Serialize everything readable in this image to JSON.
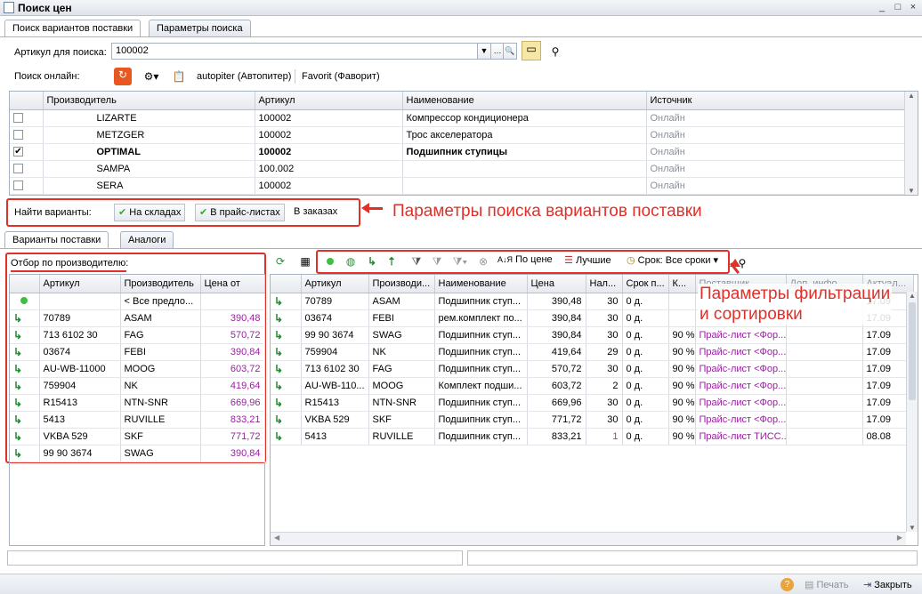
{
  "window": {
    "title": "Поиск цен",
    "buttons": [
      "_",
      "□",
      "×"
    ]
  },
  "top_tabs": [
    "Поиск вариантов поставки",
    "Параметры поиска"
  ],
  "search": {
    "label": "Артикул для поиска:",
    "value": "100002"
  },
  "online": {
    "label": "Поиск онлайн:",
    "sources": [
      "autopiter (Автопитер)",
      "Favorit (Фаворит)"
    ]
  },
  "variants_grid": {
    "columns": [
      "Производитель",
      "Артикул",
      "Наименование",
      "Источник"
    ],
    "rows": [
      {
        "checked": false,
        "maker": "LIZARTE",
        "article": "100002",
        "name": "Компрессор кондиционера",
        "source": "Онлайн",
        "bold": false
      },
      {
        "checked": false,
        "maker": "METZGER",
        "article": "100002",
        "name": "Трос акселератора",
        "source": "Онлайн",
        "bold": false
      },
      {
        "checked": true,
        "maker": "OPTIMAL",
        "article": "100002",
        "name": "Подшипник ступицы",
        "source": "Онлайн",
        "bold": true
      },
      {
        "checked": false,
        "maker": "SAMPA",
        "article": "100.002",
        "name": "",
        "source": "Онлайн",
        "bold": false
      },
      {
        "checked": false,
        "maker": "SERA",
        "article": "100002",
        "name": "",
        "source": "Онлайн",
        "bold": false
      }
    ]
  },
  "find_variants": {
    "label": "Найти варианты:",
    "buttons": [
      "На складах",
      "В прайс-листах",
      "В заказах"
    ]
  },
  "annotations": {
    "search_params": "Параметры поиска вариантов поставки",
    "filter_params_line1": "Параметры фильтрации",
    "filter_params_line2": "и сортировки"
  },
  "bottom_tabs": [
    "Варианты поставки",
    "Аналоги"
  ],
  "maker_filter": {
    "label": "Отбор по производителю:",
    "columns": [
      "Артикул",
      "Производитель",
      "Цена от"
    ],
    "all_label": "< Все предло...",
    "rows": [
      {
        "article": "70789",
        "maker": "ASAM",
        "price": "390,48"
      },
      {
        "article": "713 6102 30",
        "maker": "FAG",
        "price": "570,72"
      },
      {
        "article": "03674",
        "maker": "FEBI",
        "price": "390,84"
      },
      {
        "article": "AU-WB-11000",
        "maker": "MOOG",
        "price": "603,72"
      },
      {
        "article": "759904",
        "maker": "NK",
        "price": "419,64"
      },
      {
        "article": "R15413",
        "maker": "NTN-SNR",
        "price": "669,96"
      },
      {
        "article": "5413",
        "maker": "RUVILLE",
        "price": "833,21"
      },
      {
        "article": "VKBA 529",
        "maker": "SKF",
        "price": "771,72"
      },
      {
        "article": "99 90 3674",
        "maker": "SWAG",
        "price": "390,84"
      }
    ]
  },
  "toolbar": {
    "by_price": "По цене",
    "best": "Лучшие",
    "term": "Срок: Все сроки"
  },
  "offers_grid": {
    "columns": [
      "Артикул",
      "Производи...",
      "Наименование",
      "Цена",
      "Нал...",
      "Срок п...",
      "К...",
      "Поставщик",
      "Доп. инфо...",
      "Актуал..."
    ],
    "rows": [
      {
        "article": "70789",
        "maker": "ASAM",
        "name": "Подшипник ступ...",
        "price": "390,48",
        "qty": "30",
        "term": "0 д.",
        "k": "",
        "supplier": "",
        "extra": "",
        "date": "17.09"
      },
      {
        "article": "03674",
        "maker": "FEBI",
        "name": "рем.комплект по...",
        "price": "390,84",
        "qty": "30",
        "term": "0 д.",
        "k": "",
        "supplier": "",
        "extra": "",
        "date": "17.09"
      },
      {
        "article": "99 90 3674",
        "maker": "SWAG",
        "name": "Подшипник ступ...",
        "price": "390,84",
        "qty": "30",
        "term": "0 д.",
        "k": "90 %",
        "supplier": "Прайс-лист <Фор...",
        "extra": "",
        "date": "17.09"
      },
      {
        "article": "759904",
        "maker": "NK",
        "name": "Подшипник ступ...",
        "price": "419,64",
        "qty": "29",
        "term": "0 д.",
        "k": "90 %",
        "supplier": "Прайс-лист <Фор...",
        "extra": "",
        "date": "17.09"
      },
      {
        "article": "713 6102 30",
        "maker": "FAG",
        "name": "Подшипник ступ...",
        "price": "570,72",
        "qty": "30",
        "term": "0 д.",
        "k": "90 %",
        "supplier": "Прайс-лист <Фор...",
        "extra": "",
        "date": "17.09"
      },
      {
        "article": "AU-WB-110...",
        "maker": "MOOG",
        "name": "Комплект подши...",
        "price": "603,72",
        "qty": "2",
        "term": "0 д.",
        "k": "90 %",
        "supplier": "Прайс-лист <Фор...",
        "extra": "",
        "date": "17.09"
      },
      {
        "article": "R15413",
        "maker": "NTN-SNR",
        "name": "Подшипник ступ...",
        "price": "669,96",
        "qty": "30",
        "term": "0 д.",
        "k": "90 %",
        "supplier": "Прайс-лист <Фор...",
        "extra": "",
        "date": "17.09"
      },
      {
        "article": "VKBA 529",
        "maker": "SKF",
        "name": "Подшипник ступ...",
        "price": "771,72",
        "qty": "30",
        "term": "0 д.",
        "k": "90 %",
        "supplier": "Прайс-лист <Фор...",
        "extra": "",
        "date": "17.09"
      },
      {
        "article": "5413",
        "maker": "RUVILLE",
        "name": "Подшипник ступ...",
        "price": "833,21",
        "qty": "1",
        "term": "0 д.",
        "k": "90 %",
        "supplier": "Прайс-лист ТИСС...",
        "extra": "",
        "date": "08.08"
      }
    ]
  },
  "footer": {
    "print": "Печать",
    "close": "Закрыть",
    "help": "?"
  },
  "colors": {
    "red": "#e0302a",
    "purple": "#9a1fa1",
    "green": "#1f8a2f"
  }
}
